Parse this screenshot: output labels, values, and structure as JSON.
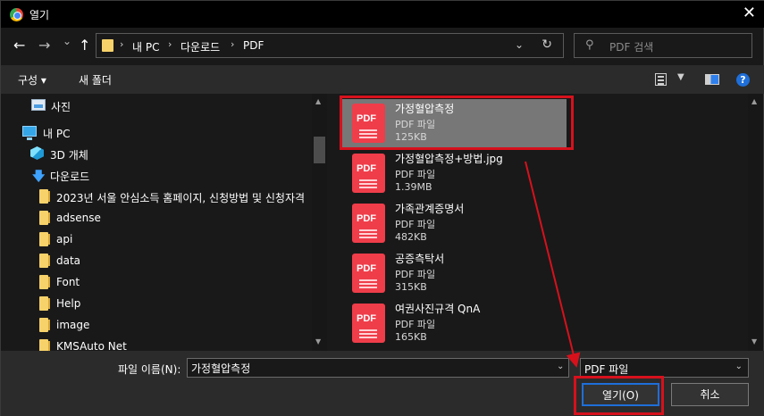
{
  "window": {
    "title": "열기",
    "close_glyph": "✕",
    "accent": "#1e6fd9",
    "annotation_color": "#d6111c"
  },
  "nav": {
    "back_glyph": "←",
    "forward_glyph": "→",
    "recent_glyph": "⌄",
    "up_glyph": "↑",
    "breadcrumb": [
      "내 PC",
      "다운로드",
      "PDF"
    ],
    "search_placeholder": "PDF 검색"
  },
  "commands": {
    "organize": "구성 ▾",
    "new_folder": "새 폴더",
    "help": "?"
  },
  "tree": [
    {
      "label": "사진",
      "icon": "pictures-icon"
    },
    {
      "label": "내 PC",
      "icon": "pc-icon"
    },
    {
      "label": "3D 개체",
      "icon": "3d-objects-icon"
    },
    {
      "label": "다운로드",
      "icon": "download-icon"
    },
    {
      "label": "2023년 서울 안심소득 홈페이지, 신청방법 및 신청자격",
      "icon": "folder-icon"
    },
    {
      "label": "adsense",
      "icon": "folder-icon"
    },
    {
      "label": "api",
      "icon": "folder-icon"
    },
    {
      "label": "data",
      "icon": "folder-icon"
    },
    {
      "label": "Font",
      "icon": "folder-icon"
    },
    {
      "label": "Help",
      "icon": "folder-icon"
    },
    {
      "label": "image",
      "icon": "folder-icon"
    },
    {
      "label": "KMSAuto Net",
      "icon": "folder-icon"
    }
  ],
  "files": [
    {
      "name": "가정혈압측정",
      "type": "PDF 파일",
      "size": "125KB",
      "selected": true
    },
    {
      "name": "가정혈압측정+방법.jpg",
      "type": "PDF 파일",
      "size": "1.39MB",
      "selected": false
    },
    {
      "name": "가족관계증명서",
      "type": "PDF 파일",
      "size": "482KB",
      "selected": false
    },
    {
      "name": "공증측탁서",
      "type": "PDF 파일",
      "size": "315KB",
      "selected": false
    },
    {
      "name": "여권사진규격 QnA",
      "type": "PDF 파일",
      "size": "165KB",
      "selected": false
    }
  ],
  "pdf_icon_text": "PDF",
  "bottom": {
    "filename_label": "파일 이름(N):",
    "filename_value": "가정혈압측정",
    "filetype_value": "PDF 파일",
    "open_button": "열기(O)",
    "cancel_button": "취소"
  }
}
